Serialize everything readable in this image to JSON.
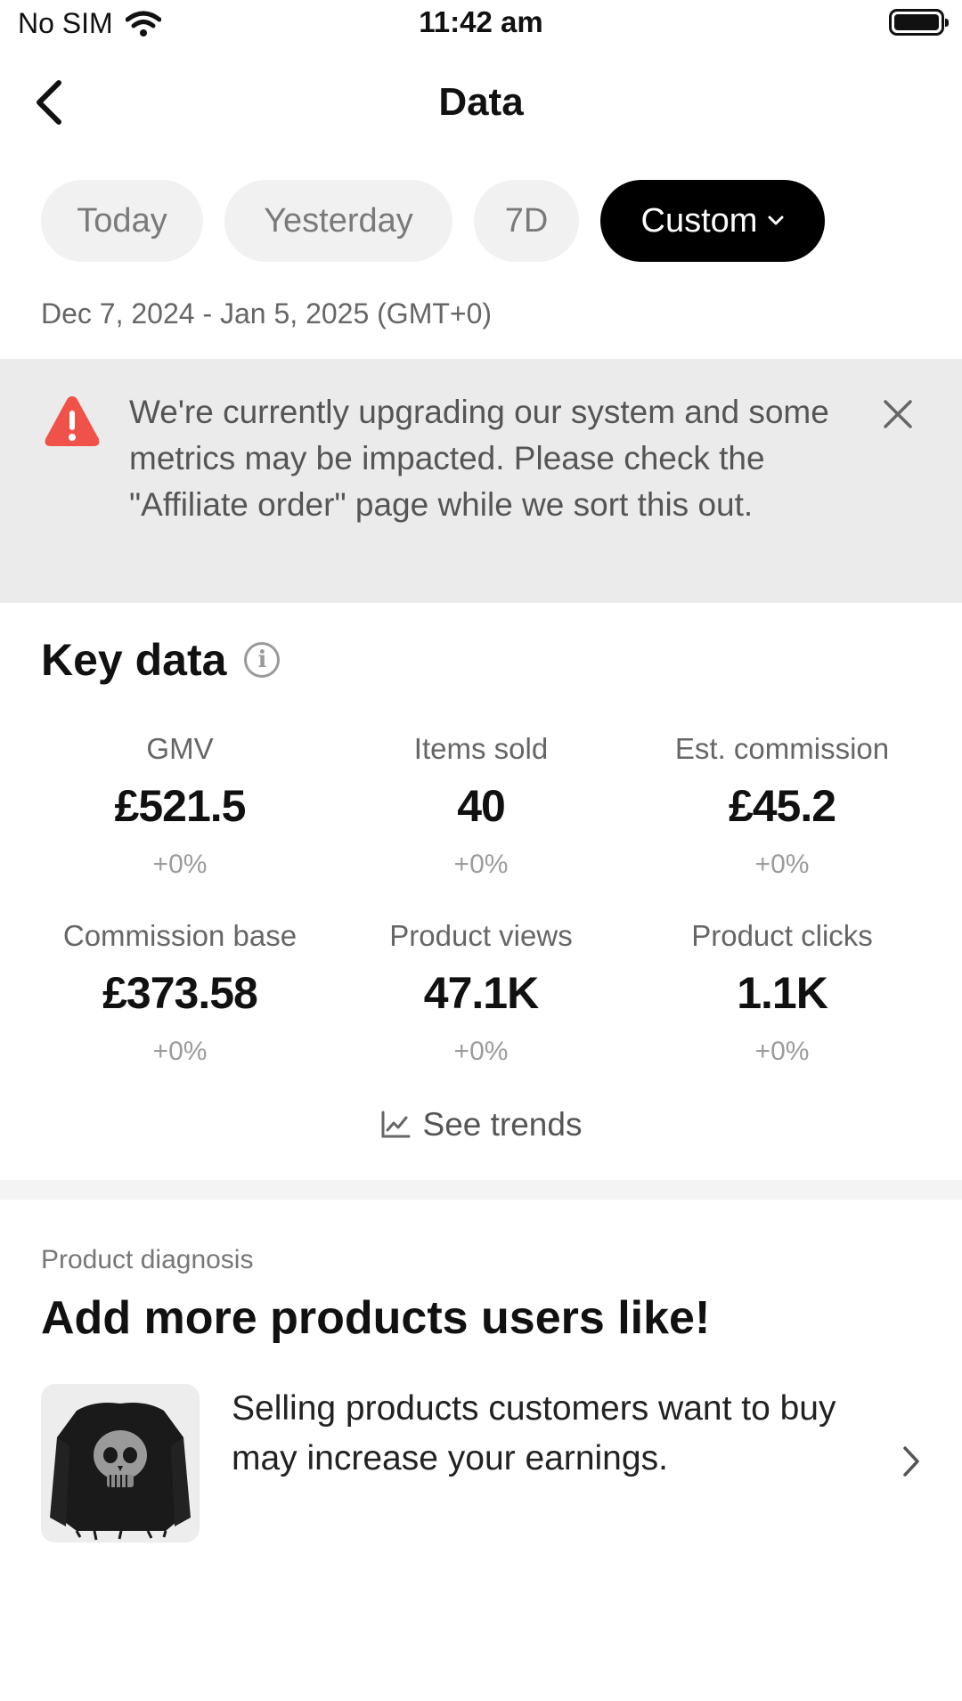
{
  "status_bar": {
    "carrier": "No SIM",
    "time": "11:42 am"
  },
  "nav": {
    "title": "Data"
  },
  "tabs": [
    {
      "label": "Today",
      "active": false
    },
    {
      "label": "Yesterday",
      "active": false
    },
    {
      "label": "7D",
      "active": false
    },
    {
      "label": "Custom",
      "active": true
    }
  ],
  "date_range": "Dec 7, 2024 - Jan 5, 2025 (GMT+0)",
  "alert": {
    "text": "We're currently upgrading our system and some metrics may be impacted. Please check the \"Affiliate order\" page while we sort this out.",
    "color": "#f0524a"
  },
  "key_data": {
    "title": "Key data",
    "metrics": [
      {
        "label": "GMV",
        "value": "£521.5",
        "change": "+0%"
      },
      {
        "label": "Items sold",
        "value": "40",
        "change": "+0%"
      },
      {
        "label": "Est. commission",
        "value": "£45.2",
        "change": "+0%"
      },
      {
        "label": "Commission base",
        "value": "£373.58",
        "change": "+0%"
      },
      {
        "label": "Product views",
        "value": "47.1K",
        "change": "+0%"
      },
      {
        "label": "Product clicks",
        "value": "1.1K",
        "change": "+0%"
      }
    ],
    "see_trends": "See trends"
  },
  "product_diagnosis": {
    "label": "Product diagnosis",
    "title": "Add more products users like!",
    "description": "Selling products customers want to buy may increase your earnings."
  }
}
